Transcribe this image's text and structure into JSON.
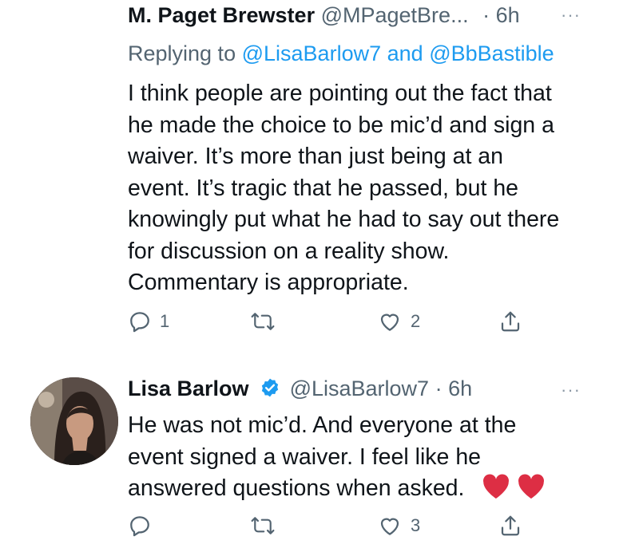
{
  "tweets": [
    {
      "author_name": "M. Paget Brewster",
      "handle": "@MPagetBre...",
      "dot": "·",
      "time": "6h",
      "more_label": "···",
      "reply_prefix": "Replying to",
      "reply_mention_1": "@LisaBarlow7",
      "reply_and": "and",
      "reply_mention_2": "@BbBastible",
      "body_lines": [
        "I think people are pointing out the fact that",
        "he made the choice to be mic’d and sign a",
        "waiver. It’s more than just being at an",
        "event. It’s tragic that he passed, but he",
        "knowingly put what he had to say out there",
        "for discussion on a reality show.",
        "Commentary is appropriate."
      ],
      "reply_count": "1",
      "retweet_count": "",
      "like_count": "2"
    },
    {
      "author_name": "Lisa Barlow",
      "handle": "@LisaBarlow7",
      "dot": "·",
      "time": "6h",
      "more_label": "···",
      "body_lines": [
        "He was not mic’d.  And everyone at the",
        "event signed a waiver. I feel like he",
        "answered questions when asked."
      ],
      "emojis": [
        "red-heart",
        "red-heart"
      ],
      "reply_count": "",
      "retweet_count": "",
      "like_count": "3"
    }
  ],
  "colors": {
    "text": "#0f1419",
    "secondary": "#536471",
    "mention": "#1d9bf0",
    "verified": "#1d9bf0",
    "heart_emoji": "#dd2e44"
  }
}
